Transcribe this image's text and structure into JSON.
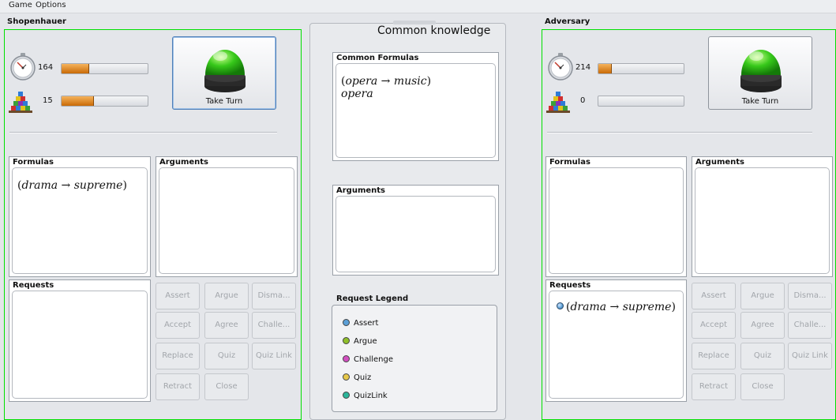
{
  "menu": {
    "items": [
      "Game",
      "Options"
    ]
  },
  "colors": {
    "player_frame": "#00e000",
    "bar_fill": "#d9780c",
    "assert": "#5b9fd6",
    "argue": "#8fbf2a",
    "challenge": "#d24fc0",
    "quiz": "#e6c84a",
    "quizlink": "#2bb59a"
  },
  "left_player": {
    "name": "Shopenhauer",
    "time_value": "164",
    "time_fill": 0.32,
    "resources_value": "15",
    "resources_fill": 0.38,
    "take_turn_label": "Take Turn",
    "formulas_title": "Formulas",
    "arguments_title": "Arguments",
    "requests_title": "Requests",
    "formulas": [
      {
        "l": "(",
        "a": "drama",
        "arrow": " → ",
        "b": "supreme",
        "r": ")"
      }
    ],
    "requests": []
  },
  "right_player": {
    "name": "Adversary",
    "time_value": "214",
    "time_fill": 0.16,
    "resources_value": "0",
    "resources_fill": 0.0,
    "take_turn_label": "Take Turn",
    "formulas_title": "Formulas",
    "arguments_title": "Arguments",
    "requests_title": "Requests",
    "formulas": [],
    "requests": [
      {
        "type": "assert",
        "l": "(",
        "a": "drama",
        "arrow": " → ",
        "b": "supreme",
        "r": ")"
      }
    ]
  },
  "actions": [
    "Assert",
    "Argue",
    "Disma...",
    "Accept",
    "Agree",
    "Challe...",
    "Replace",
    "Quiz",
    "Quiz Link",
    "Retract",
    "Close"
  ],
  "common": {
    "title": "Common knowledge",
    "formulas_title": "Common Formulas",
    "formula_1": {
      "l": "(",
      "a": "opera",
      "arrow": " → ",
      "b": "music",
      "r": ")"
    },
    "formula_2": "opera",
    "arguments_title": "Arguments",
    "legend_title": "Request Legend",
    "legend": [
      {
        "label": "Assert",
        "color": "#5b9fd6"
      },
      {
        "label": "Argue",
        "color": "#8fbf2a"
      },
      {
        "label": "Challenge",
        "color": "#d24fc0"
      },
      {
        "label": "Quiz",
        "color": "#e6c84a"
      },
      {
        "label": "QuizLink",
        "color": "#2bb59a"
      }
    ]
  }
}
